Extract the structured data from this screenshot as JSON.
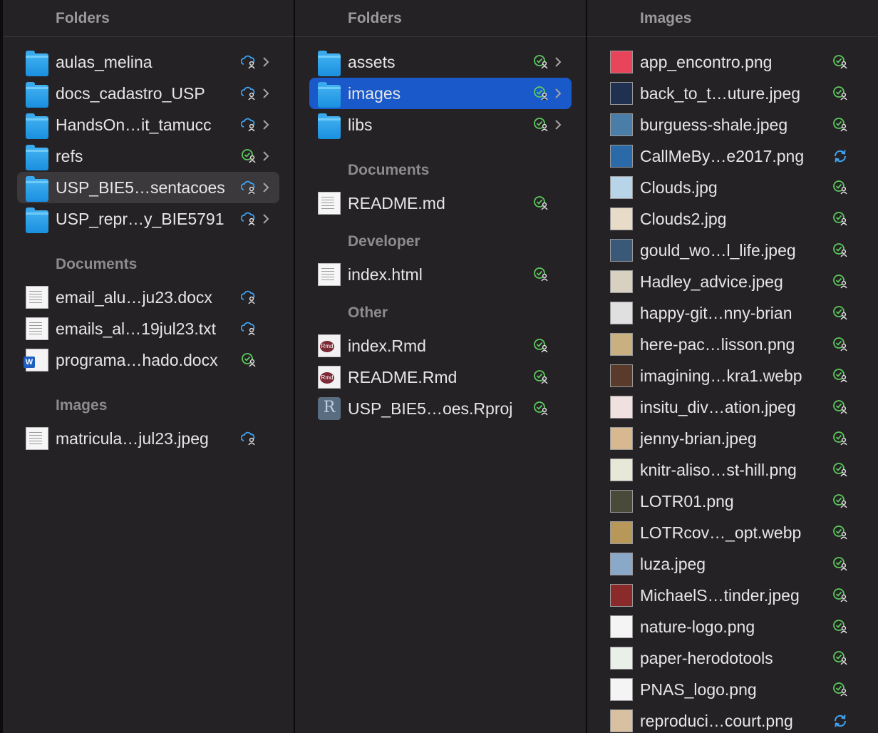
{
  "col1": {
    "header": "Folders",
    "folders": [
      {
        "label": "aulas_melina",
        "status": "cloud"
      },
      {
        "label": "docs_cadastro_USP",
        "status": "cloud"
      },
      {
        "label": "HandsOn…it_tamucc",
        "status": "cloud"
      },
      {
        "label": "refs",
        "status": "synced"
      },
      {
        "label": "USP_BIE5…sentacoes",
        "status": "cloud"
      },
      {
        "label": "USP_repr…y_BIE5791",
        "status": "cloud"
      }
    ],
    "documents_title": "Documents",
    "documents": [
      {
        "label": "email_alu…ju23.docx",
        "status": "cloud",
        "kind": "doc"
      },
      {
        "label": "emails_al…19jul23.txt",
        "status": "cloud",
        "kind": "doc"
      },
      {
        "label": "programa…hado.docx",
        "status": "synced",
        "kind": "word"
      }
    ],
    "images_title": "Images",
    "images": [
      {
        "label": "matricula…jul23.jpeg",
        "status": "cloud"
      }
    ]
  },
  "col2": {
    "header": "Folders",
    "folders": [
      {
        "label": "assets",
        "status": "synced"
      },
      {
        "label": "images",
        "status": "synced"
      },
      {
        "label": "libs",
        "status": "synced"
      }
    ],
    "documents_title": "Documents",
    "documents": [
      {
        "label": "README.md",
        "status": "synced"
      }
    ],
    "developer_title": "Developer",
    "developer": [
      {
        "label": "index.html",
        "status": "synced"
      }
    ],
    "other_title": "Other",
    "other": [
      {
        "label": "index.Rmd",
        "status": "synced",
        "kind": "rmd"
      },
      {
        "label": "README.Rmd",
        "status": "synced",
        "kind": "rmd"
      },
      {
        "label": "USP_BIE5…oes.Rproj",
        "status": "synced",
        "kind": "rproj"
      }
    ],
    "rmd_badge": "Rmd",
    "rproj_badge": "R"
  },
  "col3": {
    "header": "Images",
    "images": [
      {
        "label": "app_encontro.png",
        "status": "synced",
        "color": "#e8455a"
      },
      {
        "label": "back_to_t…uture.jpeg",
        "status": "synced",
        "color": "#203050"
      },
      {
        "label": "burguess-shale.jpeg",
        "status": "synced",
        "color": "#4a7ea8"
      },
      {
        "label": "CallMeBy…e2017.png",
        "status": "syncing",
        "color": "#2a6aa8"
      },
      {
        "label": "Clouds.jpg",
        "status": "synced",
        "color": "#b8d4e8"
      },
      {
        "label": "Clouds2.jpg",
        "status": "synced",
        "color": "#e8dcc8"
      },
      {
        "label": "gould_wo…l_life.jpeg",
        "status": "synced",
        "color": "#3a5878"
      },
      {
        "label": "Hadley_advice.jpeg",
        "status": "synced",
        "color": "#d8d0c0"
      },
      {
        "label": "happy-git…nny-brian",
        "status": "synced",
        "color": "#e0e0e0"
      },
      {
        "label": "here-pac…lisson.png",
        "status": "synced",
        "color": "#c8b080"
      },
      {
        "label": "imagining…kra1.webp",
        "status": "synced",
        "color": "#5a3a2a"
      },
      {
        "label": "insitu_div…ation.jpeg",
        "status": "synced",
        "color": "#f0e0e0"
      },
      {
        "label": "jenny-brian.jpeg",
        "status": "synced",
        "color": "#d8b890"
      },
      {
        "label": "knitr-aliso…st-hill.png",
        "status": "synced",
        "color": "#e8e8d8"
      },
      {
        "label": "LOTR01.png",
        "status": "synced",
        "color": "#4a4a3a"
      },
      {
        "label": "LOTRcov…_opt.webp",
        "status": "synced",
        "color": "#b89858"
      },
      {
        "label": "luza.jpeg",
        "status": "synced",
        "color": "#8aa8c8"
      },
      {
        "label": "MichaelS…tinder.jpeg",
        "status": "synced",
        "color": "#8a2a2a"
      },
      {
        "label": "nature-logo.png",
        "status": "synced",
        "color": "#f4f4f4"
      },
      {
        "label": "paper-herodotools",
        "status": "synced",
        "color": "#e8f0e8"
      },
      {
        "label": "PNAS_logo.png",
        "status": "synced",
        "color": "#f4f4f4"
      },
      {
        "label": "reproduci…court.png",
        "status": "syncing",
        "color": "#d8c0a0"
      }
    ]
  },
  "colors": {
    "synced": "#5cc95c",
    "cloud": "#3ea2f0",
    "syncing": "#3ea2f0",
    "selected": "#1a59c9"
  }
}
